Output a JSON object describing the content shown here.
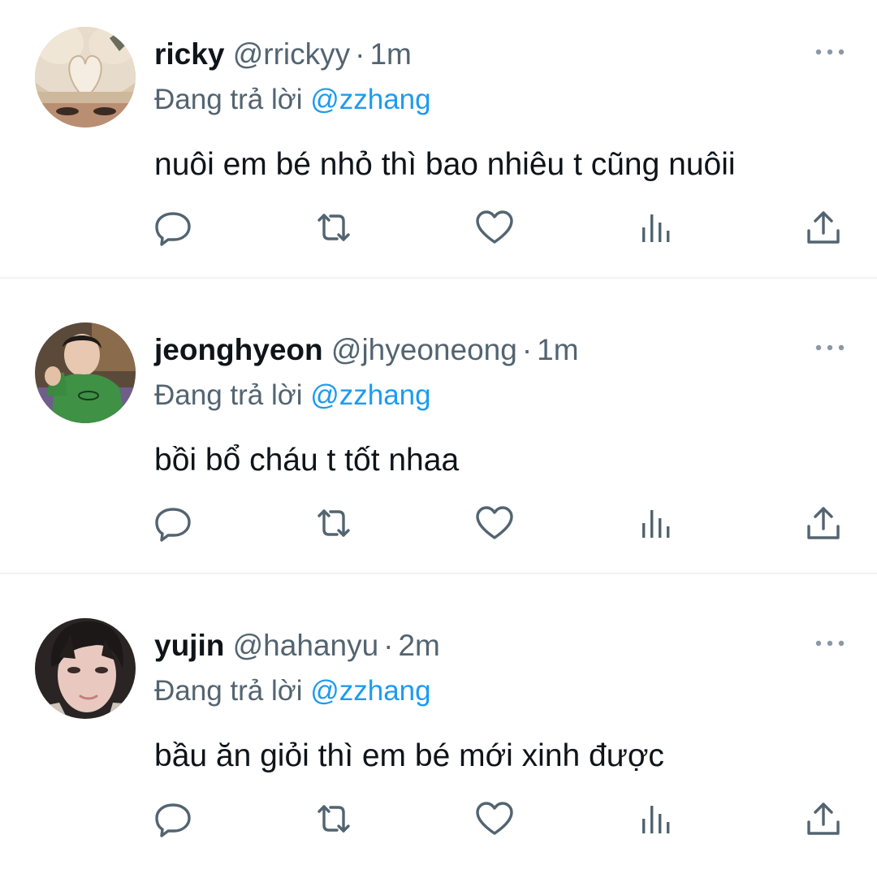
{
  "tweets": [
    {
      "display_name": "ricky",
      "handle": "@rrickyy",
      "separator": "·",
      "time": "1m",
      "reply_prefix": "Đang trả lời",
      "reply_to": "@zzhang",
      "text": "nuôi em bé nhỏ thì bao nhiêu t cũng nuôii",
      "avatar_icon": "avatar-photo-blond-hair-heart"
    },
    {
      "display_name": "jeonghyeon",
      "handle": "@jhyeoneong",
      "separator": "·",
      "time": "1m",
      "reply_prefix": "Đang trả lời",
      "reply_to": "@zzhang",
      "text": "bồi bổ cháu t tốt nhaa",
      "avatar_icon": "avatar-photo-green-sweater"
    },
    {
      "display_name": "yujin",
      "handle": "@hahanyu",
      "separator": "·",
      "time": "2m",
      "reply_prefix": "Đang trả lời",
      "reply_to": "@zzhang",
      "text": "bầu ăn giỏi thì em bé mới xinh được",
      "avatar_icon": "avatar-photo-dark-hair"
    }
  ],
  "icons": {
    "more": "more-horizontal-icon",
    "reply": "reply-bubble-icon",
    "retweet": "retweet-icon",
    "like": "heart-icon",
    "views": "analytics-bars-icon",
    "share": "share-upload-icon"
  },
  "colors": {
    "text": "#0f1419",
    "secondary": "#536471",
    "link": "#1d9bf0",
    "divider": "#eff3f4",
    "background": "#ffffff"
  }
}
